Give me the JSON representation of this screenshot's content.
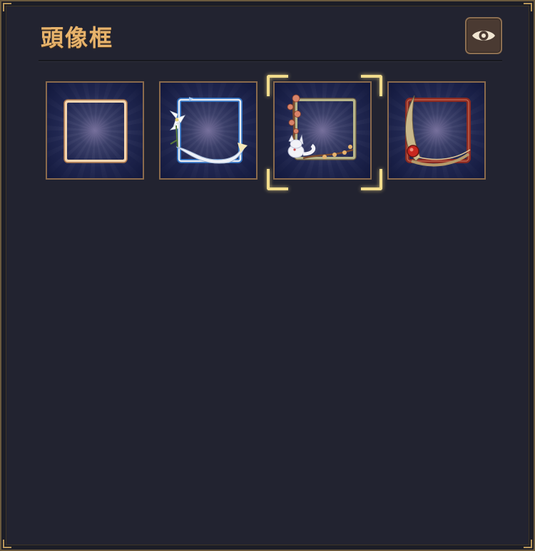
{
  "header": {
    "title": "頭像框"
  },
  "actions": {
    "preview_icon": "eye-icon"
  },
  "frames": [
    {
      "id": "basic-gold-frame",
      "icon": "basic-gold-frame-icon",
      "selected": false
    },
    {
      "id": "lily-ribbon-frame",
      "icon": "lily-ribbon-frame-icon",
      "selected": false
    },
    {
      "id": "plum-blossom-fox-frame",
      "icon": "plum-blossom-fox-frame-icon",
      "selected": true
    },
    {
      "id": "crimson-feather-frame",
      "icon": "crimson-feather-frame-icon",
      "selected": false
    }
  ],
  "colors": {
    "panel_background": "#222330",
    "title": "#e7b36c",
    "slot_border": "#8a6a4c",
    "selection_highlight": "#f2dc8c",
    "eye_button_background": "#4a3a32"
  }
}
